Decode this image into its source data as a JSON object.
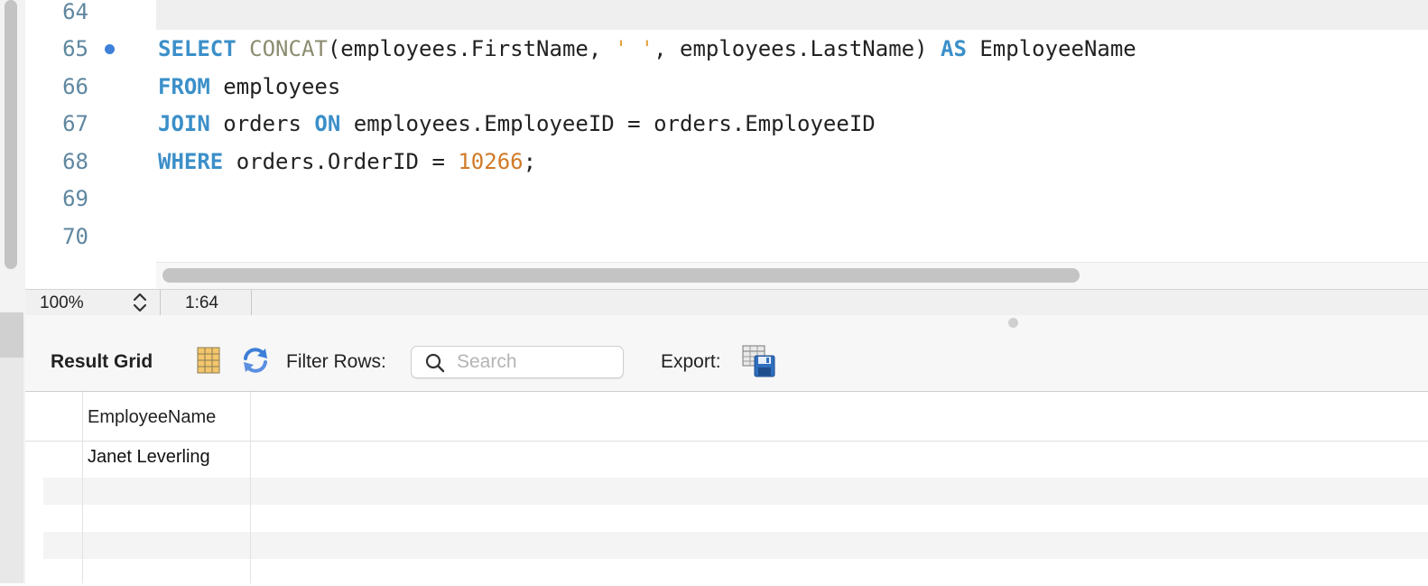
{
  "editor": {
    "line_numbers": [
      "64",
      "65",
      "66",
      "67",
      "68",
      "69",
      "70"
    ],
    "code": {
      "line65": {
        "select": "SELECT",
        "concat": "CONCAT",
        "args_a": "(employees.FirstName, ",
        "space_literal": "' '",
        "args_b": ", employees.LastName) ",
        "as": "AS",
        "alias": " EmployeeName"
      },
      "line66": {
        "from": "FROM",
        "table": " employees"
      },
      "line67": {
        "join": "JOIN",
        "table": " orders ",
        "on": "ON",
        "condition": " employees.EmployeeID = orders.EmployeeID"
      },
      "line68": {
        "where": "WHERE",
        "condition": " orders.OrderID = ",
        "value": "10266",
        "semi": ";"
      }
    }
  },
  "status_bar": {
    "zoom": "100%",
    "cursor": "1:64"
  },
  "results_toolbar": {
    "title": "Result Grid",
    "filter_label": "Filter Rows:",
    "search_placeholder": "Search",
    "export_label": "Export:"
  },
  "result_grid": {
    "columns": [
      "EmployeeName"
    ],
    "rows": [
      [
        "Janet Leverling"
      ]
    ]
  },
  "colors": {
    "keyword": "#3b8fc9",
    "function": "#8c8c70",
    "string": "#e2a23a",
    "number": "#d17a28",
    "line_number": "#5f87a0"
  },
  "icons": [
    "breakpoint-dot",
    "zoom-stepper-icon",
    "result-grid-icon",
    "refresh-icon",
    "search-icon",
    "export-icon"
  ]
}
